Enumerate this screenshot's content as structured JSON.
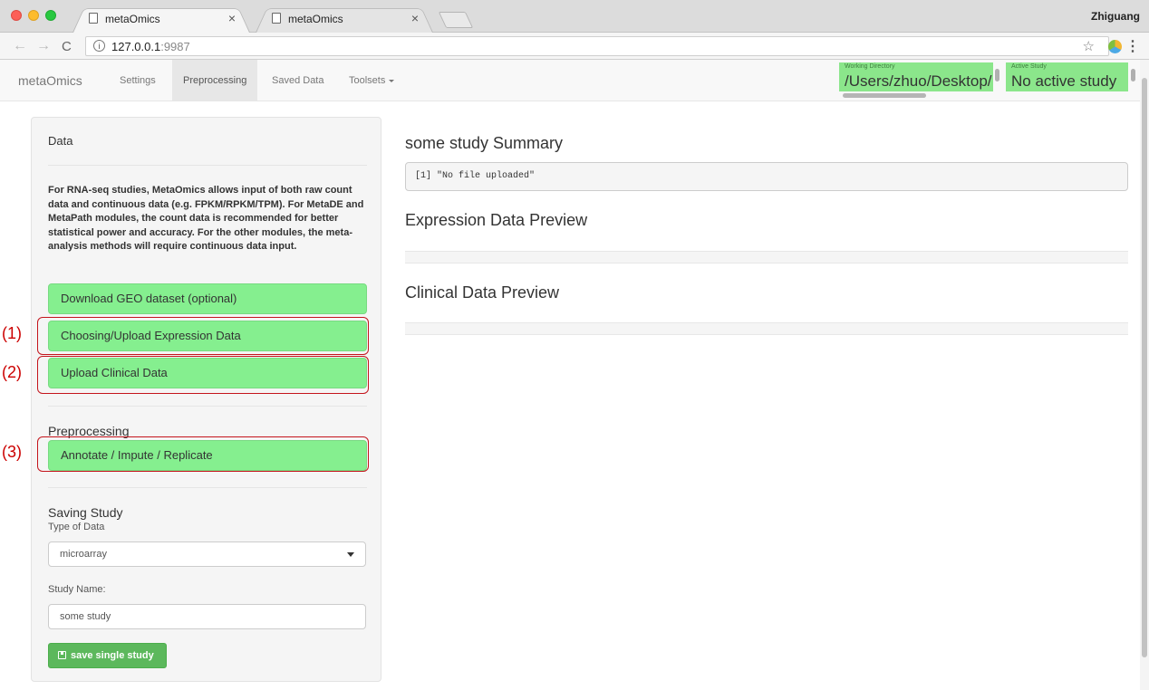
{
  "browser": {
    "tabs": [
      {
        "title": "metaOmics",
        "active": true
      },
      {
        "title": "metaOmics",
        "active": false
      }
    ],
    "user": "Zhiguang",
    "url_host": "127.0.0.1",
    "url_port": ":9987"
  },
  "navbar": {
    "brand": "metaOmics",
    "items": [
      {
        "label": "Settings"
      },
      {
        "label": "Preprocessing",
        "active": true
      },
      {
        "label": "Saved Data"
      },
      {
        "label": "Toolsets"
      }
    ],
    "working_directory": {
      "label": "Working Directory",
      "value": "/Users/zhuo/Desktop/"
    },
    "active_study": {
      "label": "Active Study",
      "value": "No active study"
    }
  },
  "sidebar": {
    "data_heading": "Data",
    "description": "For RNA-seq studies, MetaOmics allows input of both raw count data and continuous data (e.g. FPKM/RPKM/TPM). For MetaDE and MetaPath modules, the count data is recommended for better statistical power and accuracy. For the other modules, the meta-analysis methods will require continuous data input.",
    "download_geo": "Download GEO dataset (optional)",
    "upload_expression": "Choosing/Upload Expression Data",
    "upload_clinical": "Upload Clinical Data",
    "preprocessing_heading": "Preprocessing",
    "annotate": "Annotate / Impute / Replicate",
    "saving_heading": "Saving Study",
    "type_label": "Type of Data",
    "type_value": "microarray",
    "study_name_label": "Study Name:",
    "study_name_value": "some study",
    "save_button": "save single study"
  },
  "annotations": [
    "(1)",
    "(2)",
    "(3)"
  ],
  "main": {
    "summary_title": "some study Summary",
    "summary_output": "[1] \"No file uploaded\"",
    "expression_title": "Expression Data Preview",
    "clinical_title": "Clinical Data Preview"
  },
  "colors": {
    "green_button": "#85ef8f",
    "status_box": "#8be68b",
    "save_button": "#5cb85c",
    "annotation_red": "#c4141c"
  }
}
